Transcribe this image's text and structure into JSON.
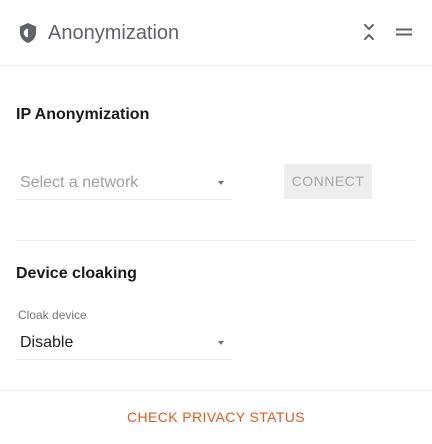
{
  "header": {
    "title": "Anonymization",
    "icons": {
      "leading": "shield-icon",
      "collapse": "collapse-icon",
      "menu": "drag-handle-icon"
    }
  },
  "ip_anonymization": {
    "title": "IP Anonymization",
    "network_select": {
      "placeholder": "Select a network",
      "value": ""
    },
    "connect_label": "CONNECT",
    "connect_enabled": false
  },
  "device_cloaking": {
    "title": "Device cloaking",
    "cloak_label": "Cloak device",
    "cloak_value": "Disable"
  },
  "footer": {
    "link_label": "CHECK PRIVACY STATUS"
  },
  "colors": {
    "accent": "#e05a1c",
    "title_gray": "#5f6368",
    "disabled_bg": "#ededed",
    "disabled_text": "#a6a6a6"
  }
}
